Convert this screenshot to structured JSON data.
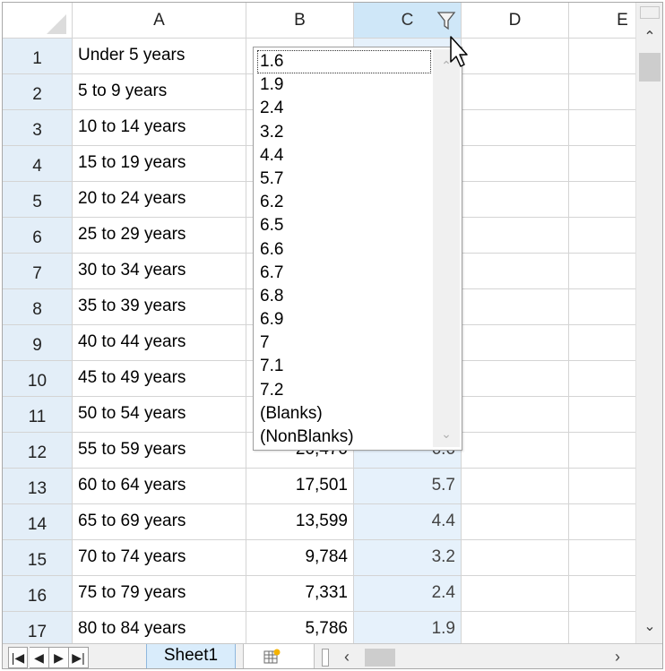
{
  "columns": [
    "A",
    "B",
    "C",
    "D",
    "E"
  ],
  "rows": [
    {
      "num": "1",
      "a": "Under 5 years",
      "b": "",
      "c": ""
    },
    {
      "num": "2",
      "a": "5 to 9 years",
      "b": "",
      "c": ""
    },
    {
      "num": "3",
      "a": "10 to 14 years",
      "b": "",
      "c": ""
    },
    {
      "num": "4",
      "a": "15 to 19 years",
      "b": "",
      "c": ""
    },
    {
      "num": "5",
      "a": "20 to 24 years",
      "b": "",
      "c": ""
    },
    {
      "num": "6",
      "a": "25 to 29 years",
      "b": "",
      "c": ""
    },
    {
      "num": "7",
      "a": "30 to 34 years",
      "b": "",
      "c": ""
    },
    {
      "num": "8",
      "a": "35 to 39 years",
      "b": "",
      "c": ""
    },
    {
      "num": "9",
      "a": "40 to 44 years",
      "b": "",
      "c": ""
    },
    {
      "num": "10",
      "a": "45 to 49 years",
      "b": "",
      "c": ""
    },
    {
      "num": "11",
      "a": "50 to 54 years",
      "b": "",
      "c": ""
    },
    {
      "num": "12",
      "a": "55 to 59 years",
      "b": "20,470",
      "c": "6.6"
    },
    {
      "num": "13",
      "a": "60 to 64 years",
      "b": "17,501",
      "c": "5.7"
    },
    {
      "num": "14",
      "a": "65 to 69 years",
      "b": "13,599",
      "c": "4.4"
    },
    {
      "num": "15",
      "a": "70 to 74 years",
      "b": "9,784",
      "c": "3.2"
    },
    {
      "num": "16",
      "a": "75 to 79 years",
      "b": "7,331",
      "c": "2.4"
    },
    {
      "num": "17",
      "a": "80 to 84 years",
      "b": "5,786",
      "c": "1.9"
    }
  ],
  "filter_dropdown": {
    "items": [
      "1.6",
      "1.9",
      "2.4",
      "3.2",
      "4.4",
      "5.7",
      "6.2",
      "6.5",
      "6.6",
      "6.7",
      "6.8",
      "6.9",
      "7",
      "7.1",
      "7.2",
      "(Blanks)",
      "(NonBlanks)"
    ],
    "focused_index": 0
  },
  "sheet_tabs": {
    "active": "Sheet1"
  },
  "colors": {
    "selected_column_header": "#cfe7f8",
    "row_header": "#e3eef8",
    "selected_column_cells": "#e6f1fb",
    "sheet_tab": "#d9ecfb"
  }
}
